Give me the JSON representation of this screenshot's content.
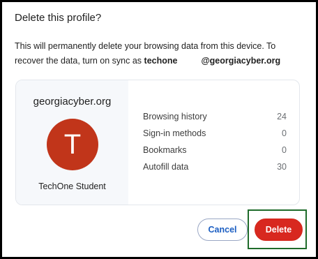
{
  "dialog": {
    "title": "Delete this profile?",
    "description_line1": "This will permanently delete your browsing data from this device. To",
    "description_line2_prefix": "recover the data, turn on sync as",
    "account_user": "techone",
    "account_domain": "@georgiacyber.org"
  },
  "profile": {
    "org": "georgiacyber.org",
    "avatar_letter": "T",
    "avatar_color": "#c1351a",
    "name": "TechOne Student"
  },
  "stats": [
    {
      "label": "Browsing history",
      "value": "24"
    },
    {
      "label": "Sign-in methods",
      "value": "0"
    },
    {
      "label": "Bookmarks",
      "value": "0"
    },
    {
      "label": "Autofill data",
      "value": "30"
    }
  ],
  "buttons": {
    "cancel": "Cancel",
    "delete": "Delete"
  },
  "colors": {
    "accent": "#1b5ec2",
    "danger": "#d8281f",
    "highlight_box": "#1e6b2a"
  }
}
